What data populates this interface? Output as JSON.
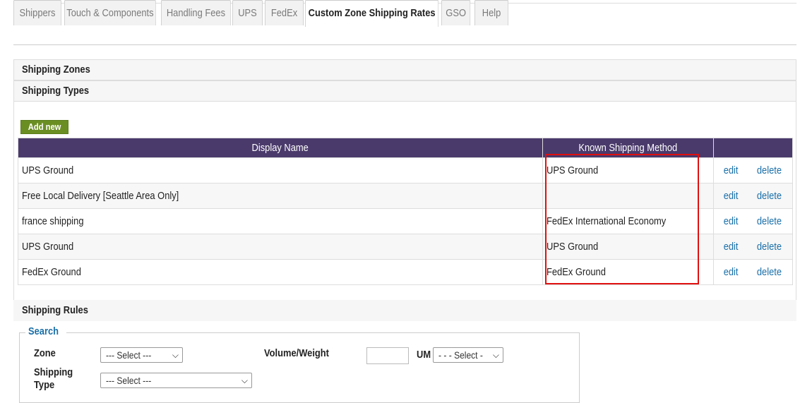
{
  "tabs": [
    {
      "label": "Shippers"
    },
    {
      "label": "Touch & Components"
    },
    {
      "label": "Handling Fees"
    },
    {
      "label": "UPS"
    },
    {
      "label": "FedEx"
    },
    {
      "label": "Custom Zone Shipping Rates",
      "active": true
    },
    {
      "label": "GSO"
    },
    {
      "label": "Help"
    }
  ],
  "sections": {
    "zones": "Shipping Zones",
    "types": "Shipping Types",
    "rules": "Shipping Rules"
  },
  "add_new_label": "Add new",
  "table": {
    "headers": [
      "Display Name",
      "Known Shipping Method",
      ""
    ],
    "rows": [
      {
        "display_name": "UPS Ground",
        "method": "UPS Ground",
        "edit": "edit",
        "delete": "delete"
      },
      {
        "display_name": "Free Local Delivery [Seattle Area Only]",
        "method": "",
        "edit": "edit",
        "delete": "delete"
      },
      {
        "display_name": "france shipping",
        "method": "FedEx International Economy",
        "edit": "edit",
        "delete": "delete"
      },
      {
        "display_name": "UPS Ground",
        "method": "UPS Ground",
        "edit": "edit",
        "delete": "delete"
      },
      {
        "display_name": "FedEx Ground",
        "method": "FedEx Ground",
        "edit": "edit",
        "delete": "delete"
      }
    ]
  },
  "search": {
    "legend": "Search",
    "zone_label": "Zone",
    "zone_value": "--- Select ---",
    "volume_weight_label": "Volume/Weight",
    "volume_weight_value": "",
    "um_label": "UM",
    "um_value": "- - - Select -",
    "shipping_type_label": "Shipping Type",
    "shipping_type_value": "--- Select ---"
  },
  "colors": {
    "header_bg": "#4a3a6b",
    "add_button": "#6b8e23",
    "link": "#1a6fa8",
    "highlight": "#e01010"
  }
}
